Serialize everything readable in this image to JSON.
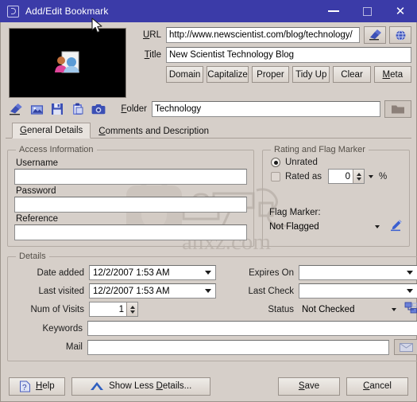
{
  "window": {
    "title": "Add/Edit Bookmark",
    "icon": "bookmark-window-icon",
    "minimize_label": "Minimize",
    "maximize_label": "Maximize",
    "close_label": "Close",
    "titlebar_color": "#3b3ba8",
    "background_color": "#d6cfc9"
  },
  "preview": {
    "label": "Page thumbnail preview",
    "background_color": "#000000"
  },
  "url": {
    "label": "URL",
    "accesskey": "U",
    "value": "http://www.newscientist.com/blog/technology/",
    "placeholder": "",
    "clear_button": "clear-url-button",
    "open_button": "open-url-button"
  },
  "title_field": {
    "label": "Title",
    "accesskey": "T",
    "value": "New Scientist Technology Blog",
    "placeholder": ""
  },
  "title_actions": [
    {
      "label": "Domain",
      "name": "domain-button"
    },
    {
      "label": "Capitalize",
      "name": "capitalize-button"
    },
    {
      "label": "Proper",
      "name": "proper-button"
    },
    {
      "label": "Tidy Up",
      "name": "tidy-up-button"
    },
    {
      "label": "Clear",
      "name": "clear-button"
    },
    {
      "label": "Meta",
      "name": "meta-button",
      "accesskey": "M"
    }
  ],
  "thumb_toolbar": [
    {
      "name": "erase-thumbnail-icon",
      "glyph": "eraser"
    },
    {
      "name": "load-image-icon",
      "glyph": "image"
    },
    {
      "name": "save-image-icon",
      "glyph": "floppy"
    },
    {
      "name": "paste-image-icon",
      "glyph": "clipboard"
    },
    {
      "name": "capture-snapshot-icon",
      "glyph": "camera"
    }
  ],
  "folder": {
    "label": "Folder",
    "accesskey": "F",
    "value": "Technology",
    "placeholder": "",
    "browse_button": "browse-folder-button"
  },
  "tabs": [
    {
      "label": "General Details",
      "accesskey": "G",
      "active": true
    },
    {
      "label": "Comments and Description",
      "accesskey": "C",
      "active": false
    }
  ],
  "access_information": {
    "legend": "Access Information",
    "username": {
      "label": "Username",
      "value": "",
      "placeholder": ""
    },
    "password": {
      "label": "Password",
      "value": "",
      "placeholder": ""
    },
    "reference": {
      "label": "Reference",
      "value": "",
      "placeholder": ""
    }
  },
  "rating": {
    "legend": "Rating and Flag Marker",
    "unrated": {
      "label": "Unrated",
      "selected": true
    },
    "rated_as": {
      "label": "Rated as",
      "selected": false,
      "value": "0",
      "suffix": "%"
    },
    "flag_marker_label": "Flag Marker:",
    "flag_marker_value": "Not Flagged",
    "edit_flag_icon": "edit-pencil-icon"
  },
  "details": {
    "legend": "Details",
    "date_added": {
      "label": "Date added",
      "value": "12/2/2007 1:53 AM"
    },
    "last_visited": {
      "label": "Last visited",
      "value": "12/2/2007 1:53 AM"
    },
    "num_of_visits": {
      "label": "Num of Visits",
      "value": "1"
    },
    "expires_on": {
      "label": "Expires On",
      "value": ""
    },
    "last_check": {
      "label": "Last Check",
      "value": ""
    },
    "status": {
      "label": "Status",
      "value": "Not Checked",
      "check_icon": "network-check-icon"
    },
    "keywords": {
      "label": "Keywords",
      "value": "",
      "placeholder": ""
    },
    "mail": {
      "label": "Mail",
      "value": "",
      "placeholder": "",
      "send_icon": "envelope-icon"
    }
  },
  "footer": {
    "help": {
      "label": "Help",
      "accesskey": "H",
      "icon": "help-icon"
    },
    "show_less": {
      "label": "Show Less Details...",
      "accesskey": "D",
      "icon": "chevron-up-icon"
    },
    "save": {
      "label": "Save",
      "accesskey": "S"
    },
    "cancel": {
      "label": "Cancel",
      "accesskey": "C"
    }
  },
  "watermark": {
    "text": "anxz.com"
  }
}
